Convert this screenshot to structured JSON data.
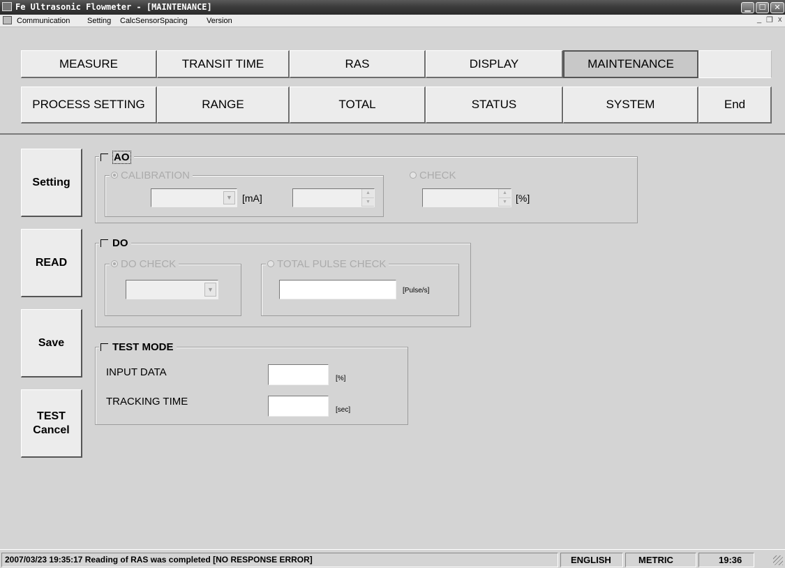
{
  "window": {
    "title": "Fe Ultrasonic Flowmeter - [MAINTENANCE]",
    "minimize": "▁",
    "maximize": "☐",
    "close": "✕"
  },
  "menu": {
    "items": [
      "Communication",
      "Setting",
      "CalcSensorSpacing",
      "Version"
    ],
    "child_minimize": "_",
    "child_restore": "❐",
    "child_close": "x"
  },
  "tabs": {
    "row1": [
      "MEASURE",
      "TRANSIT TIME",
      "RAS",
      "DISPLAY",
      "MAINTENANCE"
    ],
    "row2": [
      "PROCESS SETTING",
      "RANGE",
      "TOTAL",
      "STATUS",
      "SYSTEM",
      "End"
    ],
    "active": "MAINTENANCE"
  },
  "side_buttons": {
    "setting": "Setting",
    "read": "READ",
    "save": "Save",
    "test_cancel_line1": "TEST",
    "test_cancel_line2": "Cancel"
  },
  "ao": {
    "label": "AO",
    "checked": false,
    "calibration": {
      "label": "CALIBRATION",
      "selected": true,
      "value": "",
      "unit": "[mA]",
      "spin_value": ""
    },
    "check": {
      "label": "CHECK",
      "selected": false,
      "value": "",
      "unit": "[%]"
    }
  },
  "do": {
    "label": "DO",
    "checked": false,
    "do_check": {
      "label": "DO CHECK",
      "selected": true,
      "value": ""
    },
    "total_pulse_check": {
      "label": "TOTAL PULSE CHECK",
      "selected": false,
      "value": "",
      "unit": "[Pulse/s]"
    }
  },
  "test_mode": {
    "label": "TEST MODE",
    "checked": false,
    "input_data": {
      "label": "INPUT DATA",
      "value": "",
      "unit": "[%]"
    },
    "tracking_time": {
      "label": "TRACKING TIME",
      "value": "",
      "unit": "[sec]"
    }
  },
  "status": {
    "message": "2007/03/23 19:35:17 Reading of RAS was completed [NO RESPONSE ERROR]",
    "language": "ENGLISH",
    "units": "METRIC",
    "time": "19:36"
  },
  "colors": {
    "title_bar": "#3c3c3c",
    "face": "#d4d4d4",
    "active_tab": "#c8c8c8",
    "disabled_text": "#ababab"
  }
}
